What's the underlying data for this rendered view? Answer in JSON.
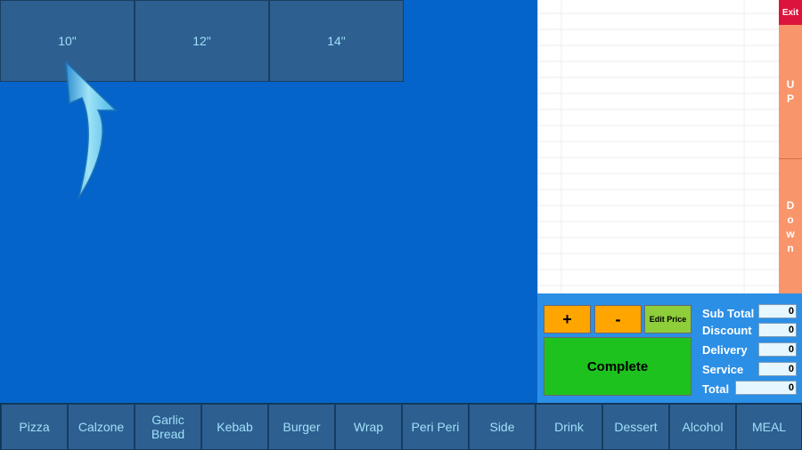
{
  "sizes": [
    {
      "label": "10\""
    },
    {
      "label": "12\""
    },
    {
      "label": "14\""
    }
  ],
  "side_buttons": {
    "exit": "Exit",
    "up": [
      "U",
      "P"
    ],
    "down": [
      "D",
      "o",
      "w",
      "n"
    ]
  },
  "controls": {
    "plus": "+",
    "minus": "-",
    "edit_price": "Edit Price",
    "complete": "Complete"
  },
  "totals": {
    "sub_total": {
      "label": "Sub Total",
      "value": "0"
    },
    "discount": {
      "label": "Discount",
      "value": "0"
    },
    "delivery": {
      "label": "Delivery",
      "value": "0"
    },
    "service": {
      "label": "Service",
      "value": "0"
    },
    "total": {
      "label": "Total",
      "value": "0"
    }
  },
  "categories": [
    {
      "label": "Pizza"
    },
    {
      "label": "Calzone"
    },
    {
      "label": "Garlic Bread"
    },
    {
      "label": "Kebab"
    },
    {
      "label": "Burger"
    },
    {
      "label": "Wrap"
    },
    {
      "label": "Peri Peri"
    },
    {
      "label": "Side"
    },
    {
      "label": "Drink"
    },
    {
      "label": "Dessert"
    },
    {
      "label": "Alcohol"
    },
    {
      "label": "MEAL"
    }
  ],
  "colors": {
    "background": "#0564c9",
    "tile": "#2d5f91",
    "tile_text": "#9fe0f6",
    "exit": "#dc143c",
    "scroll": "#f8956b",
    "orange": "#ffa500",
    "green": "#1ec21e",
    "lime": "#8fce3b"
  },
  "icons": {
    "pointer_arrow": "curved-up-arrow-icon"
  }
}
